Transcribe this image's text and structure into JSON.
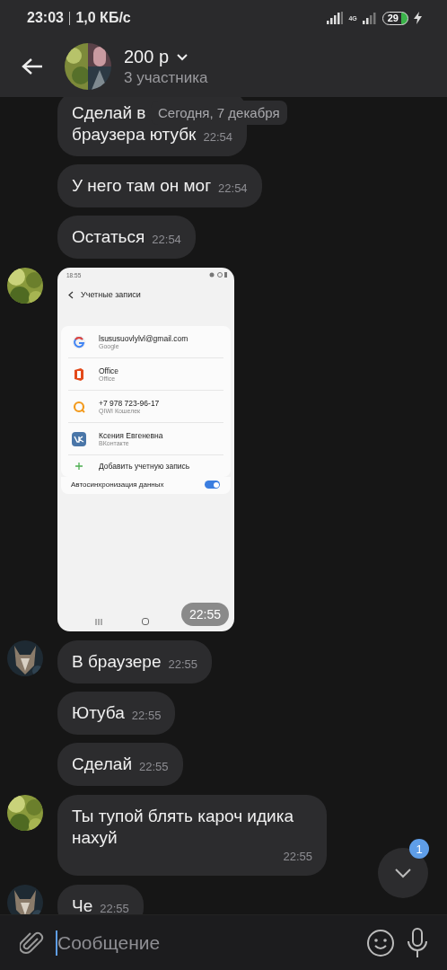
{
  "status_bar": {
    "time": "23:03",
    "speed": "1,0 КБ/с",
    "network": "4G",
    "battery": "29"
  },
  "header": {
    "title": "200 р",
    "subtitle": "3 участника"
  },
  "date_pill": "Сегодня, 7 декабря",
  "messages": [
    {
      "kind": "text",
      "avatar_shown": false,
      "text": "Сделай в\nбраузера ютубк",
      "time": "22:54"
    },
    {
      "kind": "text",
      "avatar_shown": false,
      "text": "У него там он мог",
      "time": "22:54"
    },
    {
      "kind": "text",
      "avatar_shown": false,
      "text": "Остаться",
      "time": "22:54"
    },
    {
      "avatar_shown": true,
      "time": "22:55",
      "screenshot": {
        "time": "18:55",
        "title": "Учетные записи",
        "accounts": [
          {
            "kind": "google",
            "name": "lsususuovlylvl@gmail.com",
            "service": "Google"
          },
          {
            "kind": "office",
            "name": "Office",
            "service": "Office"
          },
          {
            "kind": "qiwi",
            "name": "+7 978 723-96-17",
            "service": "QIWI Кошелек"
          },
          {
            "kind": "vk",
            "name": "Ксения Евгеневна",
            "service": "ВКонтакте"
          }
        ],
        "add_label": "Добавить учетную запись",
        "sync": {
          "label": "Автосинхронизация данных",
          "on": true
        }
      }
    },
    {
      "kind": "text",
      "avatar_shown": true,
      "text": "В браузере",
      "time": "22:55"
    },
    {
      "kind": "text",
      "avatar_shown": false,
      "text": "Ютуба",
      "time": "22:55"
    },
    {
      "kind": "text",
      "avatar_shown": false,
      "text": "Сделай",
      "time": "22:55"
    },
    {
      "kind": "text",
      "avatar_shown": true,
      "text": "Ты тупой блять кароч идика\nнахуй",
      "time": "22:55"
    },
    {
      "kind": "text",
      "avatar_shown": true,
      "text": "Че",
      "time": "22:55"
    }
  ],
  "scroll_button": {
    "badge": "1"
  },
  "composer": {
    "placeholder": "Сообщение"
  }
}
